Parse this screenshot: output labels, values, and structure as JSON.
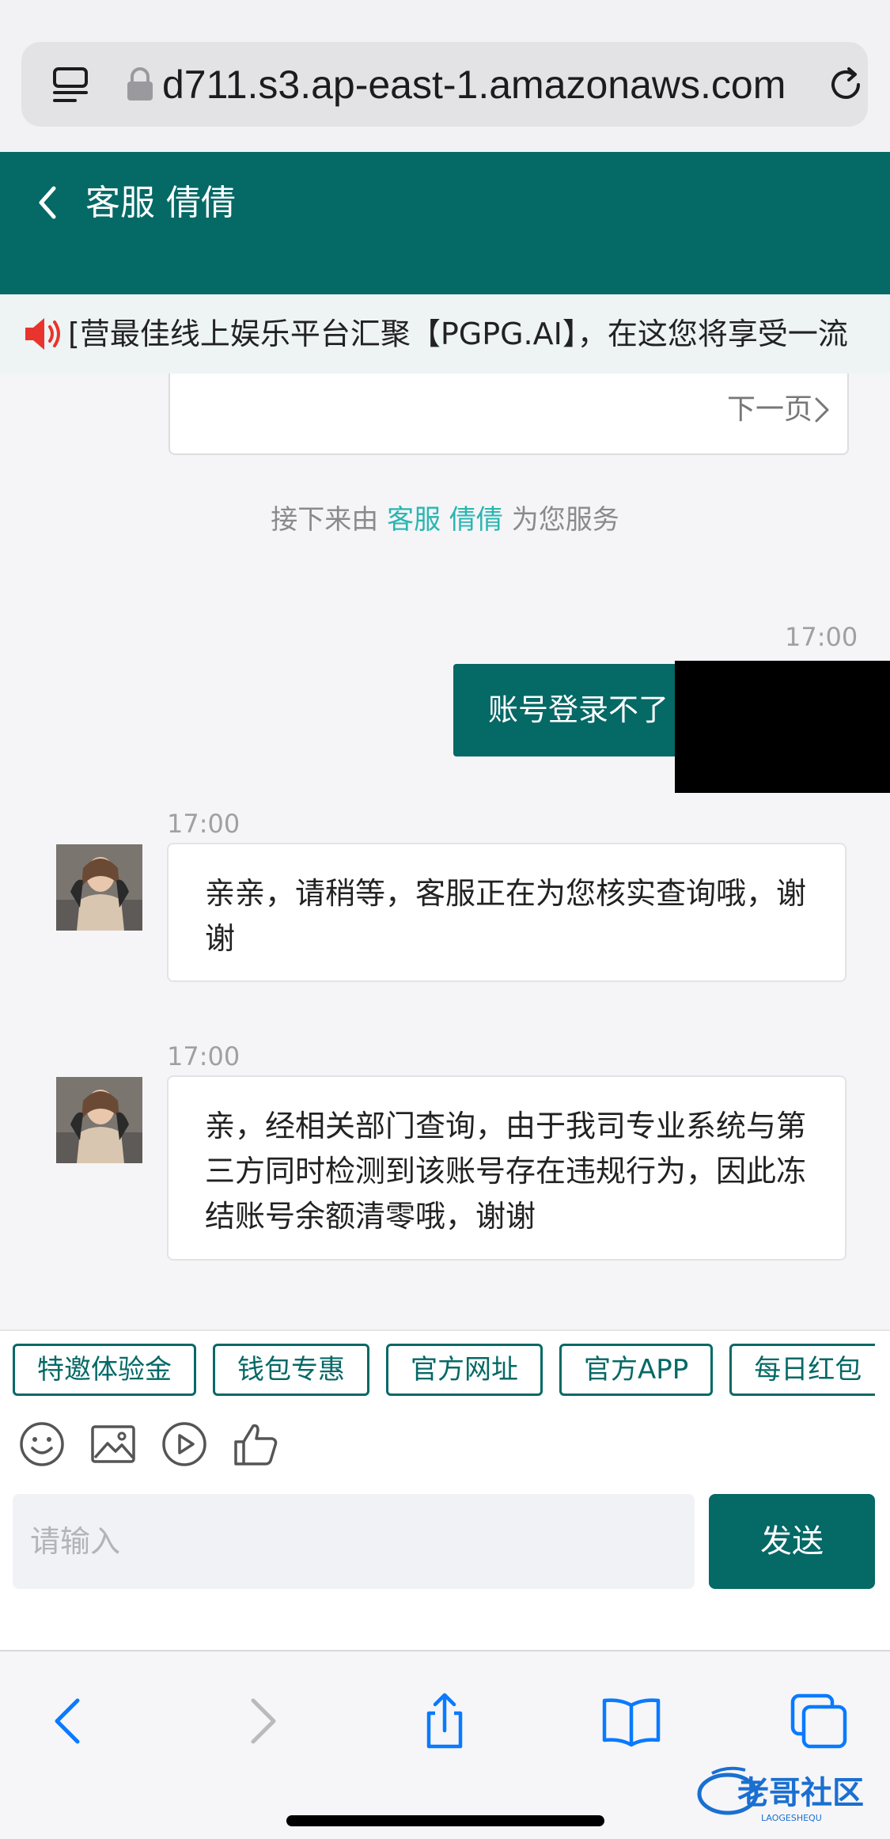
{
  "browser": {
    "url": "d711.s3.ap-east-1.amazonaws.com"
  },
  "header": {
    "title": "客服 倩倩"
  },
  "announcement": {
    "text": "[营最佳线上娱乐平台汇聚【PGPG.AI】，在这您将享受一流"
  },
  "chat": {
    "card_next_page": "下一页",
    "system_note": {
      "prefix": "接下来由",
      "agent": "客服 倩倩",
      "suffix": "为您服务"
    },
    "messages": [
      {
        "from": "user",
        "time": "17:00",
        "text": "账号登录不了"
      },
      {
        "from": "agent",
        "time": "17:00",
        "text": "亲亲，请稍等，客服正在为您核实查询哦，谢谢"
      },
      {
        "from": "agent",
        "time": "17:00",
        "text": "亲，经相关部门查询，由于我司专业系统与第三方同时检测到该账号存在违规行为，因此冻结账号余额清零哦，谢谢"
      }
    ]
  },
  "quick_actions": [
    "特邀体验金",
    "钱包专惠",
    "官方网址",
    "官方APP",
    "每日红包"
  ],
  "toolbar_icons": [
    "emoji-icon",
    "image-icon",
    "video-icon",
    "thumbs-up-icon"
  ],
  "input": {
    "placeholder": "请输入",
    "value": ""
  },
  "send_label": "发送",
  "browser_nav_icons": [
    "back-icon",
    "forward-icon",
    "share-icon",
    "bookmarks-icon",
    "tabs-icon"
  ],
  "watermark": {
    "text": "老哥社区",
    "subtext": "LAOGESHEQU"
  },
  "colors": {
    "brand": "#056966",
    "accent": "#2ab5b1",
    "ios_blue": "#0a7aff"
  }
}
